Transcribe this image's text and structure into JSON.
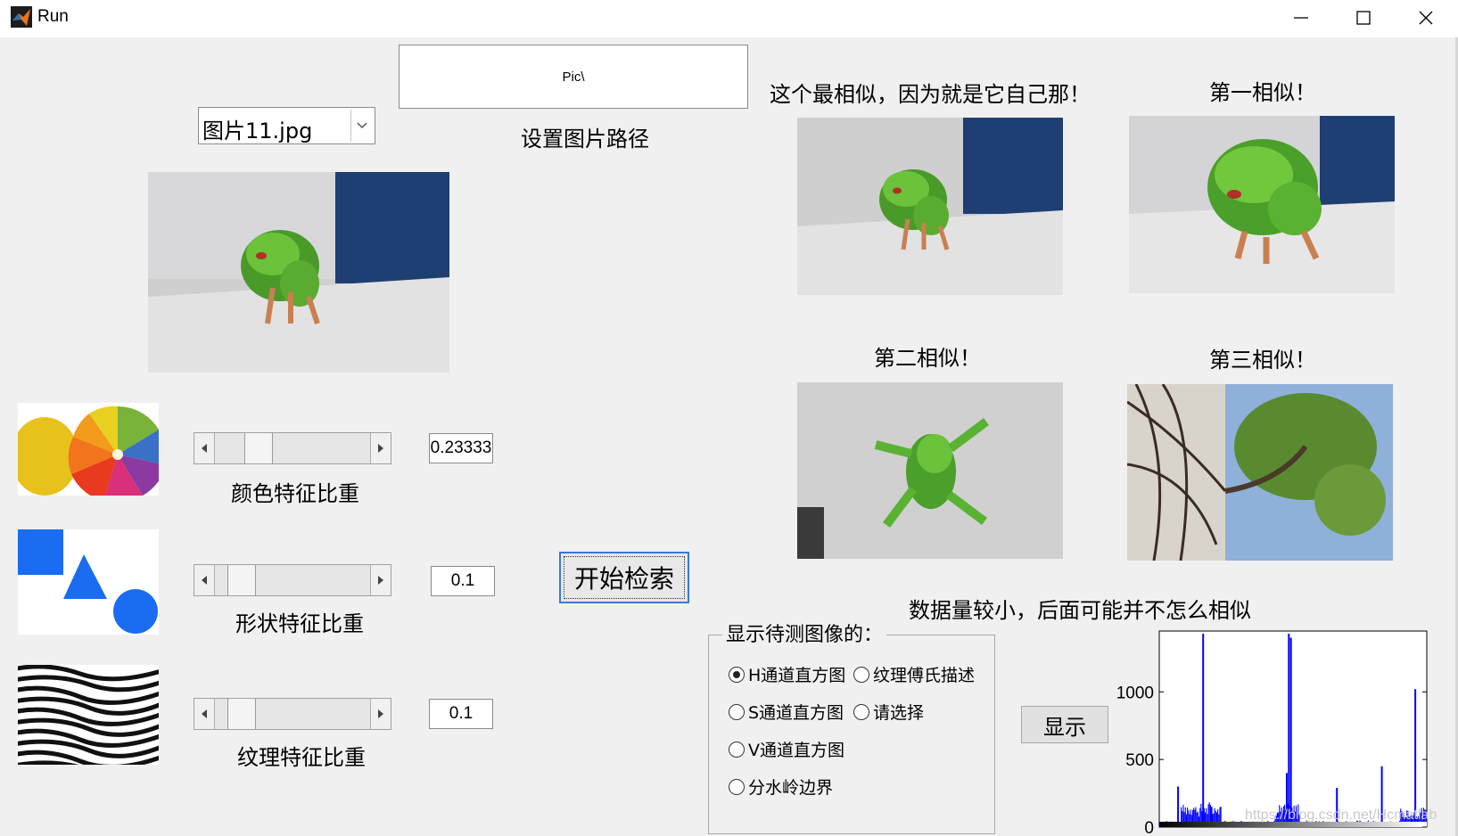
{
  "window": {
    "title": "Run",
    "controls": [
      "minimize",
      "maximize",
      "close"
    ]
  },
  "path": {
    "value": "Pic\\",
    "label": "设置图片路径"
  },
  "dropdown": {
    "selected": "图片11.jpg"
  },
  "features": [
    {
      "label": "颜色特征比重",
      "value": "0.23333",
      "level": 0.23333,
      "icon": "color-wheel-image"
    },
    {
      "label": "形状特征比重",
      "value": "0.1",
      "level": 0.1,
      "icon": "shapes-image"
    },
    {
      "label": "纹理特征比重",
      "value": "0.1",
      "level": 0.1,
      "icon": "zebra-texture-image"
    }
  ],
  "search_button": "开始检索",
  "results": {
    "best": "这个最相似，因为就是它自己那！",
    "first": "第一相似！",
    "second": "第二相似！",
    "third": "第三相似！",
    "note": "数据量较小，后面可能并不怎么相似"
  },
  "display_group": {
    "title": "显示待测图像的：",
    "options": [
      {
        "label": "H通道直方图",
        "selected": true
      },
      {
        "label": "纹理傅氏描述",
        "selected": false
      },
      {
        "label": "S通道直方图",
        "selected": false
      },
      {
        "label": "请选择",
        "selected": false
      },
      {
        "label": "V通道直方图",
        "selected": false
      },
      {
        "label": "分水岭边界",
        "selected": false
      }
    ]
  },
  "show_button": "显示",
  "watermark": "https://blog.csdn.net/Hcmatlab",
  "chart_data": {
    "type": "bar",
    "title": "",
    "xlabel": "",
    "ylabel": "",
    "yticks": [
      0,
      500,
      1000
    ],
    "ylim": [
      0,
      1450
    ],
    "xlim": [
      0,
      256
    ],
    "peaks": [
      {
        "x": 18,
        "y": 300
      },
      {
        "x": 42,
        "y": 1430
      },
      {
        "x": 50,
        "y": 150
      },
      {
        "x": 122,
        "y": 400
      },
      {
        "x": 124,
        "y": 1430
      },
      {
        "x": 126,
        "y": 1400
      },
      {
        "x": 170,
        "y": 290
      },
      {
        "x": 213,
        "y": 450
      },
      {
        "x": 245,
        "y": 1020
      }
    ],
    "colors": {
      "bars": "#0000ff",
      "background": "#ffffff"
    }
  }
}
